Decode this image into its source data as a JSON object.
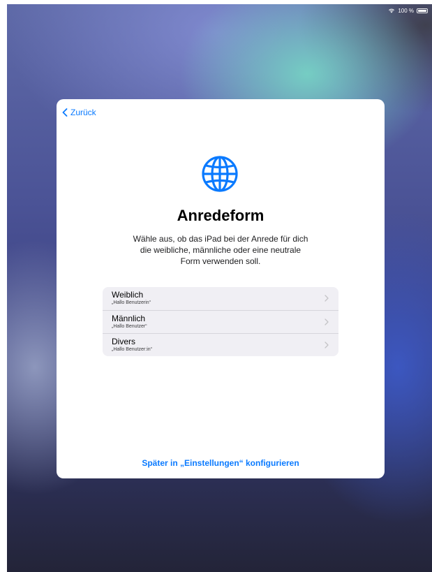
{
  "status_bar": {
    "battery_text": "100 %",
    "icons": [
      "wifi-icon",
      "battery-icon"
    ]
  },
  "sheet": {
    "back_label": "Zurück",
    "icon": "globe-icon",
    "title": "Anredeform",
    "description": "Wähle aus, ob das iPad bei der Anrede für dich die weibliche, männliche oder eine neutrale Form verwenden soll.",
    "options": [
      {
        "label": "Weiblich",
        "example": "„Hallo Benutzerin“"
      },
      {
        "label": "Männlich",
        "example": "„Hallo Benutzer“"
      },
      {
        "label": "Divers",
        "example": "„Hallo Benutzer:in“"
      }
    ],
    "later_link": "Später in „Einstellungen“ konfigurieren"
  },
  "colors": {
    "accent": "#0a7aff",
    "sheet_background": "#ffffff",
    "options_background": "#f0eff4"
  }
}
